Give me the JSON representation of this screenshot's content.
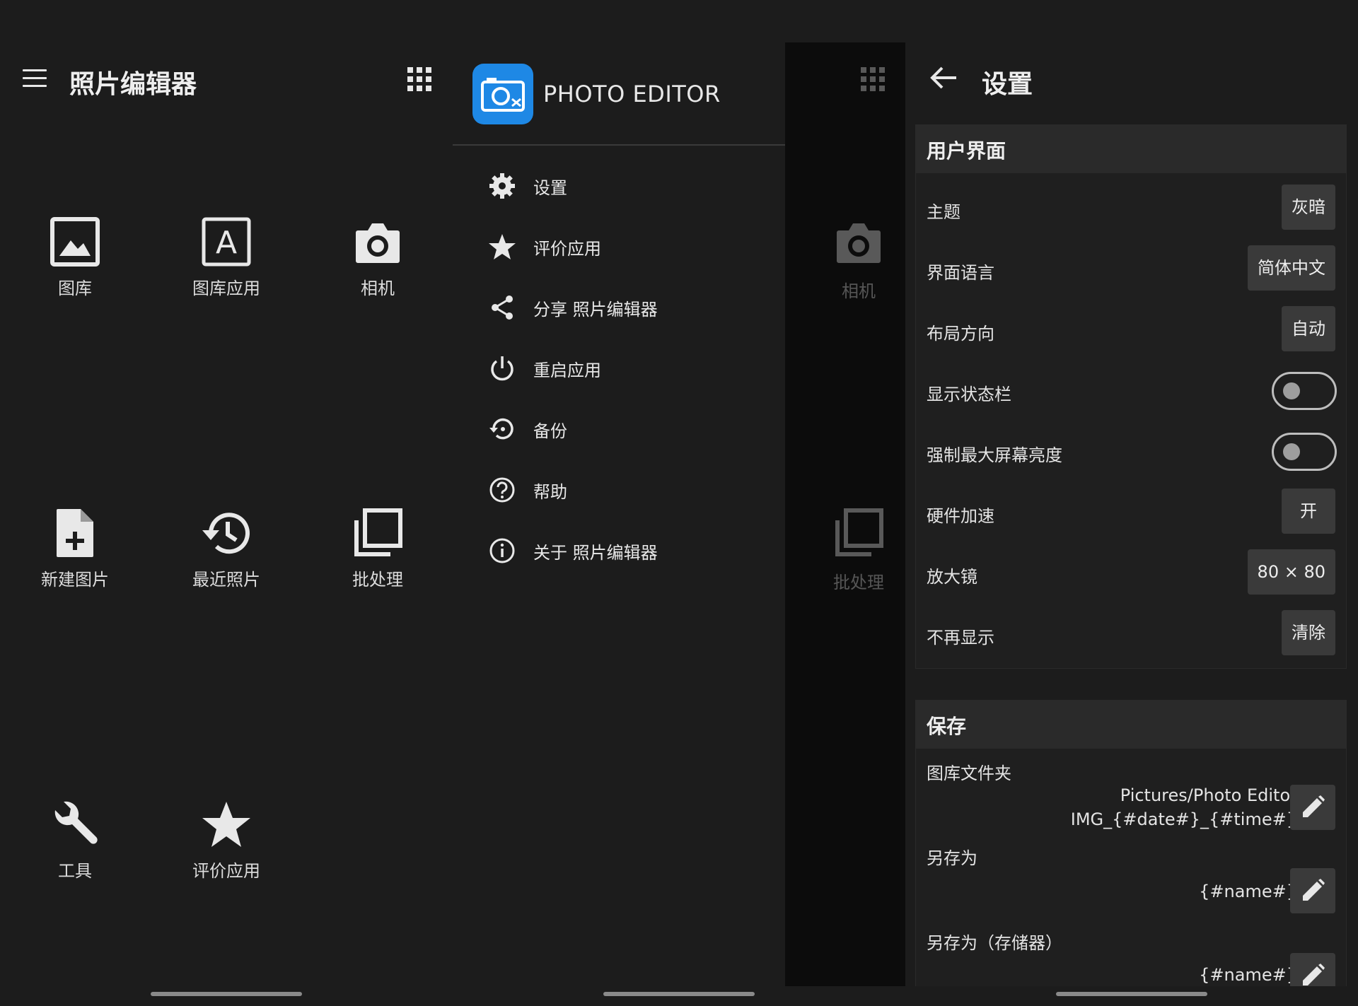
{
  "home": {
    "title": "照片编辑器",
    "tiles": [
      {
        "label": "图库",
        "icon": "image-icon"
      },
      {
        "label": "图库应用",
        "icon": "font-a-icon"
      },
      {
        "label": "相机",
        "icon": "camera-icon"
      },
      {
        "label": "新建图片",
        "icon": "new-file-icon"
      },
      {
        "label": "最近照片",
        "icon": "history-icon"
      },
      {
        "label": "批处理",
        "icon": "batch-icon"
      },
      {
        "label": "工具",
        "icon": "wrench-icon"
      },
      {
        "label": "评价应用",
        "icon": "star-icon"
      }
    ]
  },
  "drawer": {
    "app_name": "PHOTO EDITOR",
    "items": [
      {
        "label": "设置",
        "icon": "gear-icon"
      },
      {
        "label": "评价应用",
        "icon": "star-icon"
      },
      {
        "label": "分享 照片编辑器",
        "icon": "share-icon"
      },
      {
        "label": "重启应用",
        "icon": "power-icon"
      },
      {
        "label": "备份",
        "icon": "restore-icon"
      },
      {
        "label": "帮助",
        "icon": "help-icon"
      },
      {
        "label": "关于 照片编辑器",
        "icon": "info-icon"
      }
    ],
    "behind_tiles": [
      "相机",
      "批处理"
    ]
  },
  "settings": {
    "title": "设置",
    "ui_section": {
      "header": "用户界面",
      "rows": [
        {
          "label": "主题",
          "value": "灰暗"
        },
        {
          "label": "界面语言",
          "value": "简体中文"
        },
        {
          "label": "布局方向",
          "value": "自动"
        },
        {
          "label": "显示状态栏",
          "toggle": false
        },
        {
          "label": "强制最大屏幕亮度",
          "toggle": false
        },
        {
          "label": "硬件加速",
          "value": "开"
        },
        {
          "label": "放大镜",
          "value": "80 × 80"
        },
        {
          "label": "不再显示",
          "value": "清除"
        }
      ]
    },
    "save_section": {
      "header": "保存",
      "items": [
        {
          "label": "图库文件夹",
          "value_line1": "Pictures/Photo Editor",
          "value_line2": "IMG_{#date#}_{#time#}"
        },
        {
          "label": "另存为",
          "value_line1": "{#name#}"
        },
        {
          "label": "另存为（存储器）",
          "value_line1": "{#name#}"
        }
      ]
    }
  },
  "colors": {
    "accent": "#1e88e5",
    "background": "#1c1c1c",
    "button": "#3a3a3a"
  }
}
